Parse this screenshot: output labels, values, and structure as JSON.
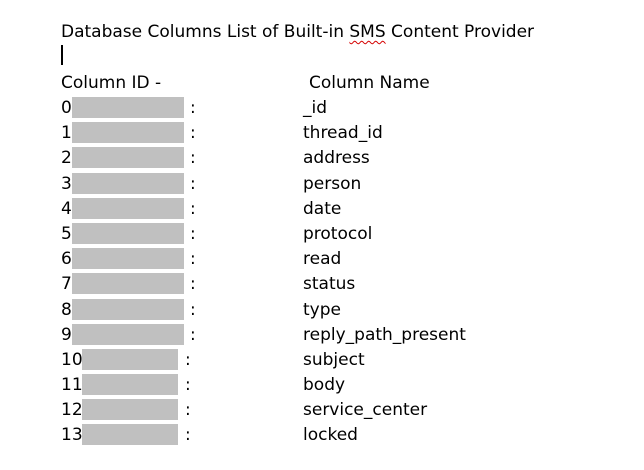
{
  "document": {
    "title_before": "Database Columns List of Built-in ",
    "title_misspelled": "SMS",
    "title_after": " Content Provider",
    "header_id": "Column ID  -",
    "header_name": "Column Name",
    "separator": ":",
    "rows": [
      {
        "id": "0",
        "name": "_id"
      },
      {
        "id": "1",
        "name": "thread_id"
      },
      {
        "id": "2",
        "name": "address"
      },
      {
        "id": "3",
        "name": "person"
      },
      {
        "id": "4",
        "name": "date"
      },
      {
        "id": "5",
        "name": "protocol"
      },
      {
        "id": "6",
        "name": "read"
      },
      {
        "id": "7",
        "name": "status"
      },
      {
        "id": "8",
        "name": "type"
      },
      {
        "id": "9",
        "name": "reply_path_present"
      },
      {
        "id": "10",
        "name": "subject"
      },
      {
        "id": "11",
        "name": "body"
      },
      {
        "id": "12",
        "name": "service_center"
      },
      {
        "id": "13",
        "name": "locked"
      }
    ]
  },
  "colors": {
    "redaction": "#c0c0c0",
    "spellcheck": "#d40000",
    "text": "#000000",
    "background": "#ffffff"
  }
}
